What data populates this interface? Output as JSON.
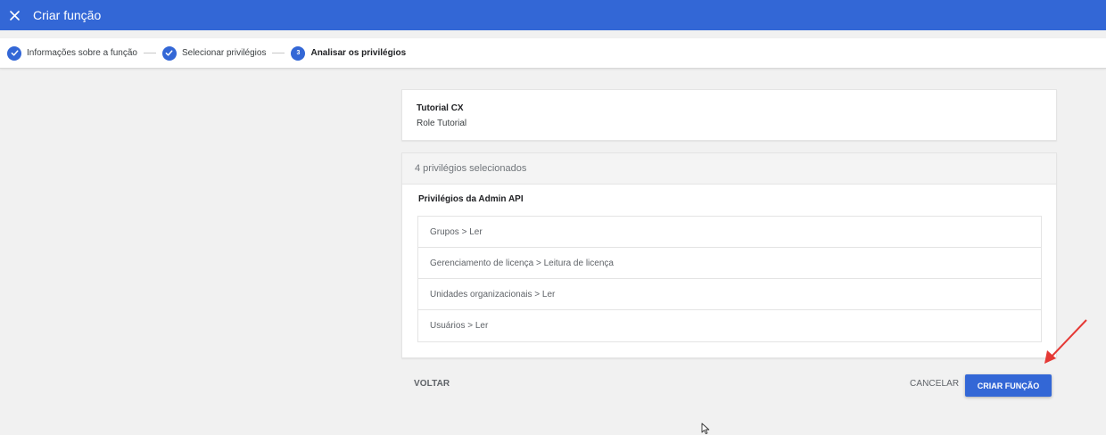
{
  "appbar": {
    "title": "Criar função"
  },
  "stepper": {
    "steps": [
      {
        "label": "Informações sobre a função",
        "state": "done"
      },
      {
        "label": "Selecionar privilégios",
        "state": "done"
      },
      {
        "label": "Analisar os privilégios",
        "state": "active",
        "number": "3"
      }
    ]
  },
  "role": {
    "name": "Tutorial CX",
    "description": "Role Tutorial"
  },
  "privileges": {
    "header": "4 privilégios selecionados",
    "group_title": "Privilégios da Admin API",
    "items": [
      "Grupos > Ler",
      "Gerenciamento de licença > Leitura de licença",
      "Unidades organizacionais > Ler",
      "Usuários > Ler"
    ]
  },
  "actions": {
    "back_label": "VOLTAR",
    "cancel_label": "CANCELAR",
    "create_label": "CRIAR FUNÇÃO"
  },
  "colors": {
    "brand": "#3367d6",
    "annotation": "#e53935"
  },
  "icons": {
    "close": "close-icon",
    "check": "check-icon",
    "arrow": "annotation-arrow",
    "cursor": "mouse-cursor"
  }
}
